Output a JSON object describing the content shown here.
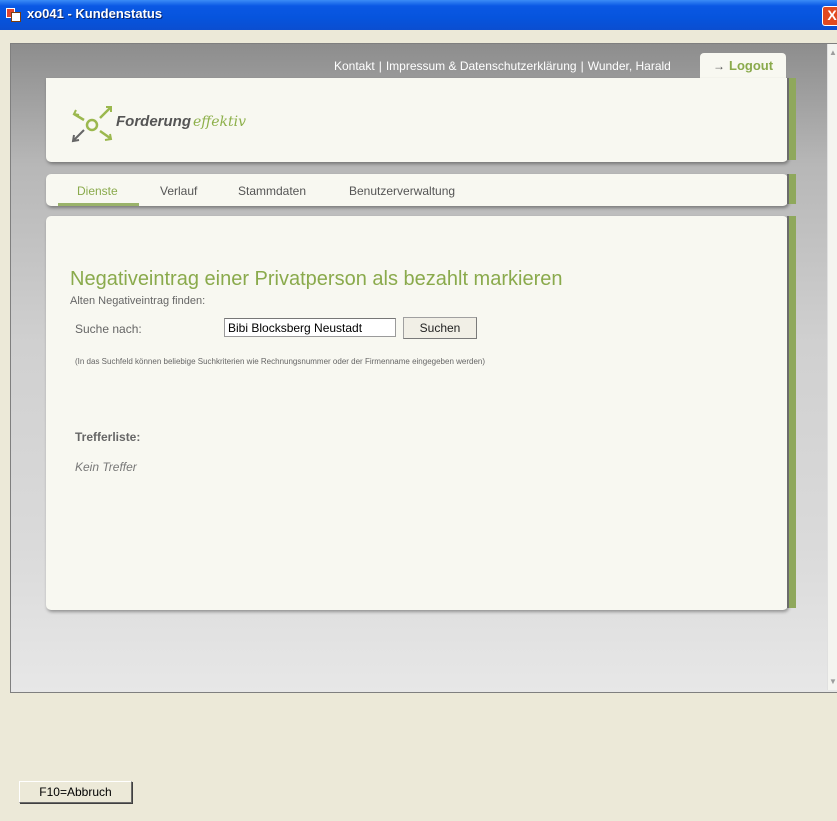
{
  "window": {
    "title": "xo041 - Kundenstatus",
    "close_label": "X"
  },
  "topnav": {
    "items": [
      "Kontakt",
      "Impressum & Datenschutzerklärung",
      "Wunder, Harald"
    ],
    "separator": "|",
    "logout_arrow": "→",
    "logout_label": "Logout"
  },
  "logo": {
    "word1": "Forderung",
    "word2": "effektiv"
  },
  "tabs": [
    {
      "label": "Dienste",
      "active": true
    },
    {
      "label": "Verlauf",
      "active": false
    },
    {
      "label": "Stammdaten",
      "active": false
    },
    {
      "label": "Benutzerverwaltung",
      "active": false
    }
  ],
  "main": {
    "title": "Negativeintrag einer Privatperson als bezahlt markieren",
    "subtitle": "Alten Negativeintrag finden:",
    "search_label": "Suche nach:",
    "search_value": "Bibi Blocksberg Neustadt",
    "search_button": "Suchen",
    "hint": "(In das Suchfeld können beliebige Suchkriterien wie Rechnungsnummer oder der Firmenname eingegeben werden)",
    "results_label": "Trefferliste:",
    "no_results": "Kein Treffer"
  },
  "footer": {
    "f10_label": "F10=Abbruch"
  },
  "colors": {
    "accent_green": "#8aaa4c",
    "titlebar_blue": "#0654dd"
  }
}
